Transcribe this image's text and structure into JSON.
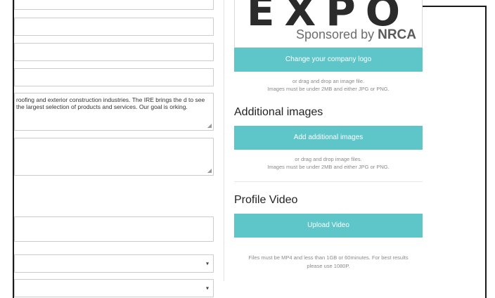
{
  "form": {
    "description_text": "roofing and exterior construction industries. The IRE brings the d to see the largest selection of products and services. Our goal is orking.",
    "resize_glyph": "◢",
    "select_caret": "▾"
  },
  "logo": {
    "word": "EXPO",
    "sponsor_prefix": "Sponsored by",
    "sponsor_brand": "NRCA"
  },
  "logo_upload": {
    "button_label": "Change your company logo",
    "hint_line1": "or drag and drop an image file.",
    "hint_line2": "Images must be under 2MB and either JPG or PNG."
  },
  "additional_images": {
    "title": "Additional images",
    "button_label": "Add additional images",
    "hint_line1": "or drag and drop image files.",
    "hint_line2": "Images must be under 2MB and either JPG or PNG."
  },
  "profile_video": {
    "title": "Profile Video",
    "button_label": "Upload Video",
    "hint_line1": "Files must be MP4 and less than 1GB or 60minutes. For best results",
    "hint_line2": "please use 1080P."
  },
  "colors": {
    "accent": "#5ec6c8",
    "border": "#cccccc",
    "frame": "#1a1a1a"
  }
}
